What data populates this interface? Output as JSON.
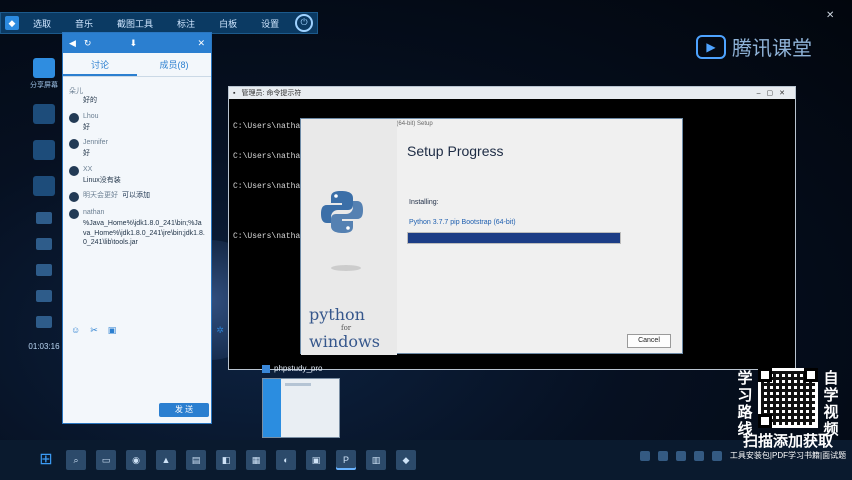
{
  "top_toolbar": {
    "items": [
      "选取",
      "音乐",
      "截图工具",
      "标注",
      "白板",
      "设置"
    ]
  },
  "left_rail": {
    "share_label": "分享屏幕",
    "time": "01:03:16"
  },
  "chat": {
    "tabs": [
      "讨论",
      "成员(8)"
    ],
    "messages": [
      {
        "name": "朵儿",
        "text": "好的"
      },
      {
        "name": "Lhou",
        "text": "好"
      },
      {
        "name": "Jennifer",
        "text": "好"
      },
      {
        "name": "XX",
        "text": "Linux没有装"
      },
      {
        "name": "明天会更好",
        "text": "可以添加"
      },
      {
        "name": "nathan",
        "text": "%Java_Home%\\jdk1.8.0_241\\bin;%Java_Home%\\jdk1.8.0_241\\jre\\bin;jdk1.8.0_241\\lib\\tools.jar"
      }
    ],
    "send_label": "发 送"
  },
  "cmd": {
    "title": "管理员: 命令提示符",
    "lines": [
      "C:\\Users\\nathan>",
      "C:\\Users\\nathan>",
      "C:\\Users\\nathan>",
      "",
      "C:\\Users\\nathan>"
    ]
  },
  "setup": {
    "title": "Python 3.7.7 (64-bit) Setup",
    "heading": "Setup Progress",
    "status": "Installing:",
    "detail": "Python 3.7.7 pip Bootstrap (64-bit)",
    "progress": 1.0,
    "cancel_label": "Cancel",
    "logo_word_1": "python",
    "logo_word_2": "for",
    "logo_word_3": "windows"
  },
  "preview": {
    "label": "phpstudy_pro"
  },
  "brand": {
    "name": "腾讯课堂"
  },
  "promo": {
    "left_text": "学习路线",
    "right_text": "自学视频",
    "cta": "扫描添加获取",
    "sub": "工具安装包|PDF学习书籍|面试题"
  },
  "colors": {
    "accent": "#2b7fd0",
    "progress": "#1c3d86",
    "desktop": "#050b18"
  }
}
